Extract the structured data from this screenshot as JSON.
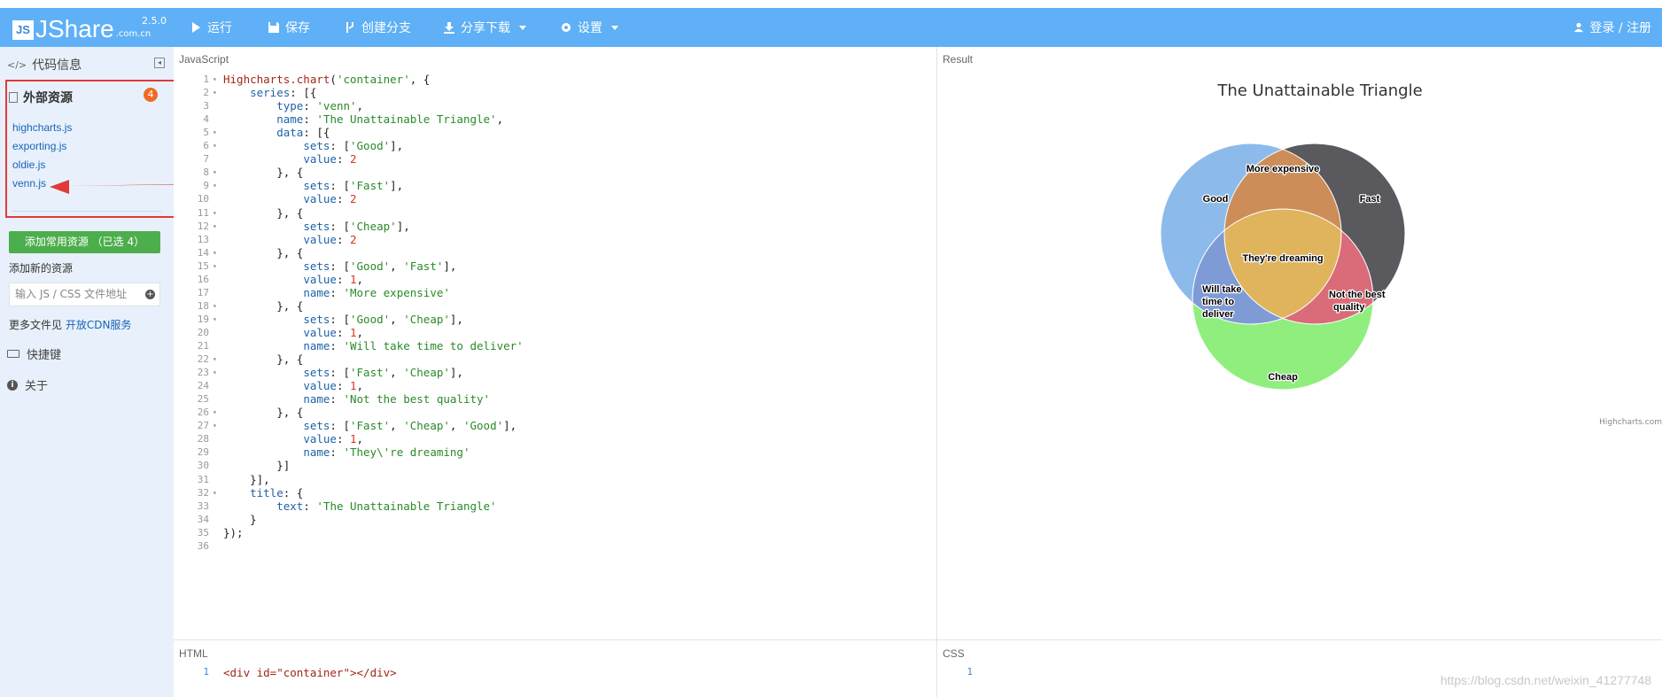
{
  "app": {
    "logo_mark": "JS",
    "logo_text": "JShare",
    "logo_domain": ".com.cn",
    "version": "2.5.0",
    "colors": {
      "navbar": "#5fb0f6",
      "sidebar": "#e8f1fb",
      "highlight_box": "#e03a3a",
      "add_button": "#4cae4c",
      "badge": "#f06a20"
    }
  },
  "navbar": {
    "run": "运行",
    "save": "保存",
    "branch": "创建分支",
    "share": "分享下载",
    "settings": "设置",
    "login": "登录 / 注册"
  },
  "sidebar": {
    "code_info": "代码信息",
    "external_resources": "外部资源",
    "resource_count": "4",
    "resources": [
      "highcharts.js",
      "exporting.js",
      "oldie.js",
      "venn.js"
    ],
    "add_common_button": "添加常用资源 （已选 4）",
    "add_new_label": "添加新的资源",
    "url_placeholder": "输入 JS / CSS 文件地址",
    "more_files_prefix": "更多文件见 ",
    "more_files_link": "开放CDN服务",
    "shortcuts": "快捷键",
    "about": "关于"
  },
  "panels": {
    "javascript": "JavaScript",
    "result": "Result",
    "html": "HTML",
    "css": "CSS"
  },
  "js_code": [
    "Highcharts.chart('container', {",
    "    series: [{",
    "        type: 'venn',",
    "        name: 'The Unattainable Triangle',",
    "        data: [{",
    "            sets: ['Good'],",
    "            value: 2",
    "        }, {",
    "            sets: ['Fast'],",
    "            value: 2",
    "        }, {",
    "            sets: ['Cheap'],",
    "            value: 2",
    "        }, {",
    "            sets: ['Good', 'Fast'],",
    "            value: 1,",
    "            name: 'More expensive'",
    "        }, {",
    "            sets: ['Good', 'Cheap'],",
    "            value: 1,",
    "            name: 'Will take time to deliver'",
    "        }, {",
    "            sets: ['Fast', 'Cheap'],",
    "            value: 1,",
    "            name: 'Not the best quality'",
    "        }, {",
    "            sets: ['Fast', 'Cheap', 'Good'],",
    "            value: 1,",
    "            name: 'They\\'re dreaming'",
    "        }]",
    "    }],",
    "    title: {",
    "        text: 'The Unattainable Triangle'",
    "    }",
    "});",
    ""
  ],
  "fold_lines": [
    1,
    2,
    5,
    6,
    8,
    9,
    11,
    12,
    14,
    15,
    18,
    19,
    22,
    23,
    26,
    27,
    32
  ],
  "html_code": {
    "line_no": "1",
    "text": "<div id=\"container\"></div>"
  },
  "css_code": {
    "line_no": "1"
  },
  "chart": {
    "title": "The Unattainable Triangle",
    "credits": "Highcharts.com",
    "labels": {
      "good": "Good",
      "fast": "Fast",
      "cheap": "Cheap",
      "good_fast": "More expensive",
      "fast_cheap": [
        "Not the best",
        "quality"
      ],
      "good_cheap": [
        "Will take",
        "time to",
        "deliver"
      ],
      "all": "They're dreaming"
    },
    "colors": {
      "good": "#8cbbeb",
      "fast": "#5a5a5e",
      "cheap": "#90ee7e",
      "good_fast": "#cc8d58",
      "good_cheap": "#7f9bd6",
      "fast_cheap": "#d96c78",
      "all": "#e0b45c"
    }
  },
  "chart_data": {
    "type": "venn",
    "title": "The Unattainable Triangle",
    "series_name": "The Unattainable Triangle",
    "sets": [
      {
        "sets": [
          "Good"
        ],
        "value": 2
      },
      {
        "sets": [
          "Fast"
        ],
        "value": 2
      },
      {
        "sets": [
          "Cheap"
        ],
        "value": 2
      },
      {
        "sets": [
          "Good",
          "Fast"
        ],
        "value": 1,
        "name": "More expensive"
      },
      {
        "sets": [
          "Good",
          "Cheap"
        ],
        "value": 1,
        "name": "Will take time to deliver"
      },
      {
        "sets": [
          "Fast",
          "Cheap"
        ],
        "value": 1,
        "name": "Not the best quality"
      },
      {
        "sets": [
          "Fast",
          "Cheap",
          "Good"
        ],
        "value": 1,
        "name": "They're dreaming"
      }
    ]
  },
  "watermark": "https://blog.csdn.net/weixin_41277748"
}
